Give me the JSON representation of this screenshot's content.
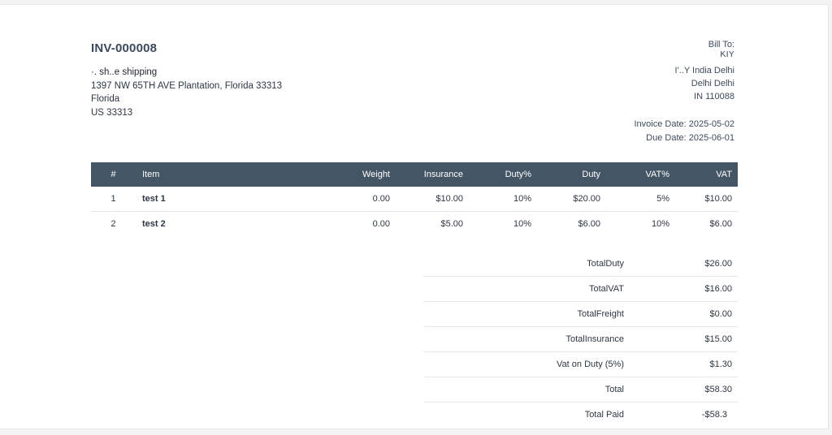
{
  "invoice": {
    "number": "INV-000008"
  },
  "from": {
    "company": "·. sh..e shipping",
    "address_line1": "1397 NW 65TH AVE Plantation, Florida 33313",
    "state": "Florida",
    "country_zip": "US 33313"
  },
  "bill_to": {
    "label": "Bill To:",
    "name": "ΚΙΥ",
    "line1": "Ι'..Y India Delhi",
    "line2": "Delhi Delhi",
    "line3": "IN 110088"
  },
  "dates": {
    "invoice_date": "Invoice Date: 2025-05-02",
    "due_date": "Due Date: 2025-06-01"
  },
  "items_table": {
    "headers": {
      "num": "#",
      "item": "Item",
      "weight": "Weight",
      "insurance": "Insurance",
      "duty_pct": "Duty%",
      "duty": "Duty",
      "vat_pct": "VAT%",
      "vat": "VAT"
    },
    "rows": [
      {
        "num": "1",
        "item": "test 1",
        "weight": "0.00",
        "insurance": "$10.00",
        "duty_pct": "10%",
        "duty": "$20.00",
        "vat_pct": "5%",
        "vat": "$10.00"
      },
      {
        "num": "2",
        "item": "test 2",
        "weight": "0.00",
        "insurance": "$5.00",
        "duty_pct": "10%",
        "duty": "$6.00",
        "vat_pct": "10%",
        "vat": "$6.00"
      }
    ]
  },
  "totals": [
    {
      "label": "TotalDuty",
      "value": "$26.00"
    },
    {
      "label": "TotalVAT",
      "value": "$16.00"
    },
    {
      "label": "TotalFreight",
      "value": "$0.00"
    },
    {
      "label": "TotalInsurance",
      "value": "$15.00"
    },
    {
      "label": "Vat on Duty (5%)",
      "value": "$1.30"
    },
    {
      "label": "Total",
      "value": "$58.30"
    },
    {
      "label": "Total Paid",
      "value": "-$58.3"
    }
  ]
}
